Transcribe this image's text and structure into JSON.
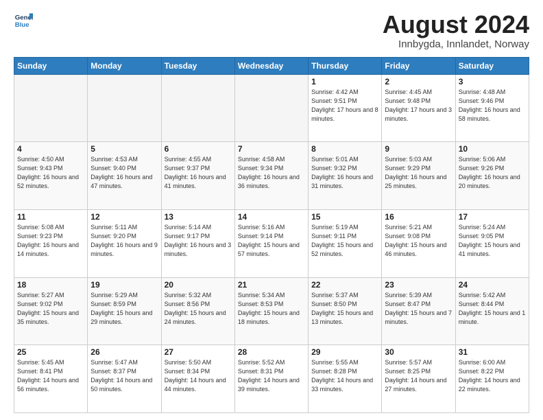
{
  "header": {
    "logo": {
      "line1": "General",
      "line2": "Blue"
    },
    "title": "August 2024",
    "subtitle": "Innbygda, Innlandet, Norway"
  },
  "weekdays": [
    "Sunday",
    "Monday",
    "Tuesday",
    "Wednesday",
    "Thursday",
    "Friday",
    "Saturday"
  ],
  "weeks": [
    [
      {
        "day": "",
        "info": ""
      },
      {
        "day": "",
        "info": ""
      },
      {
        "day": "",
        "info": ""
      },
      {
        "day": "",
        "info": ""
      },
      {
        "day": "1",
        "info": "Sunrise: 4:42 AM\nSunset: 9:51 PM\nDaylight: 17 hours\nand 8 minutes."
      },
      {
        "day": "2",
        "info": "Sunrise: 4:45 AM\nSunset: 9:48 PM\nDaylight: 17 hours\nand 3 minutes."
      },
      {
        "day": "3",
        "info": "Sunrise: 4:48 AM\nSunset: 9:46 PM\nDaylight: 16 hours\nand 58 minutes."
      }
    ],
    [
      {
        "day": "4",
        "info": "Sunrise: 4:50 AM\nSunset: 9:43 PM\nDaylight: 16 hours\nand 52 minutes."
      },
      {
        "day": "5",
        "info": "Sunrise: 4:53 AM\nSunset: 9:40 PM\nDaylight: 16 hours\nand 47 minutes."
      },
      {
        "day": "6",
        "info": "Sunrise: 4:55 AM\nSunset: 9:37 PM\nDaylight: 16 hours\nand 41 minutes."
      },
      {
        "day": "7",
        "info": "Sunrise: 4:58 AM\nSunset: 9:34 PM\nDaylight: 16 hours\nand 36 minutes."
      },
      {
        "day": "8",
        "info": "Sunrise: 5:01 AM\nSunset: 9:32 PM\nDaylight: 16 hours\nand 31 minutes."
      },
      {
        "day": "9",
        "info": "Sunrise: 5:03 AM\nSunset: 9:29 PM\nDaylight: 16 hours\nand 25 minutes."
      },
      {
        "day": "10",
        "info": "Sunrise: 5:06 AM\nSunset: 9:26 PM\nDaylight: 16 hours\nand 20 minutes."
      }
    ],
    [
      {
        "day": "11",
        "info": "Sunrise: 5:08 AM\nSunset: 9:23 PM\nDaylight: 16 hours\nand 14 minutes."
      },
      {
        "day": "12",
        "info": "Sunrise: 5:11 AM\nSunset: 9:20 PM\nDaylight: 16 hours\nand 9 minutes."
      },
      {
        "day": "13",
        "info": "Sunrise: 5:14 AM\nSunset: 9:17 PM\nDaylight: 16 hours\nand 3 minutes."
      },
      {
        "day": "14",
        "info": "Sunrise: 5:16 AM\nSunset: 9:14 PM\nDaylight: 15 hours\nand 57 minutes."
      },
      {
        "day": "15",
        "info": "Sunrise: 5:19 AM\nSunset: 9:11 PM\nDaylight: 15 hours\nand 52 minutes."
      },
      {
        "day": "16",
        "info": "Sunrise: 5:21 AM\nSunset: 9:08 PM\nDaylight: 15 hours\nand 46 minutes."
      },
      {
        "day": "17",
        "info": "Sunrise: 5:24 AM\nSunset: 9:05 PM\nDaylight: 15 hours\nand 41 minutes."
      }
    ],
    [
      {
        "day": "18",
        "info": "Sunrise: 5:27 AM\nSunset: 9:02 PM\nDaylight: 15 hours\nand 35 minutes."
      },
      {
        "day": "19",
        "info": "Sunrise: 5:29 AM\nSunset: 8:59 PM\nDaylight: 15 hours\nand 29 minutes."
      },
      {
        "day": "20",
        "info": "Sunrise: 5:32 AM\nSunset: 8:56 PM\nDaylight: 15 hours\nand 24 minutes."
      },
      {
        "day": "21",
        "info": "Sunrise: 5:34 AM\nSunset: 8:53 PM\nDaylight: 15 hours\nand 18 minutes."
      },
      {
        "day": "22",
        "info": "Sunrise: 5:37 AM\nSunset: 8:50 PM\nDaylight: 15 hours\nand 13 minutes."
      },
      {
        "day": "23",
        "info": "Sunrise: 5:39 AM\nSunset: 8:47 PM\nDaylight: 15 hours\nand 7 minutes."
      },
      {
        "day": "24",
        "info": "Sunrise: 5:42 AM\nSunset: 8:44 PM\nDaylight: 15 hours\nand 1 minute."
      }
    ],
    [
      {
        "day": "25",
        "info": "Sunrise: 5:45 AM\nSunset: 8:41 PM\nDaylight: 14 hours\nand 56 minutes."
      },
      {
        "day": "26",
        "info": "Sunrise: 5:47 AM\nSunset: 8:37 PM\nDaylight: 14 hours\nand 50 minutes."
      },
      {
        "day": "27",
        "info": "Sunrise: 5:50 AM\nSunset: 8:34 PM\nDaylight: 14 hours\nand 44 minutes."
      },
      {
        "day": "28",
        "info": "Sunrise: 5:52 AM\nSunset: 8:31 PM\nDaylight: 14 hours\nand 39 minutes."
      },
      {
        "day": "29",
        "info": "Sunrise: 5:55 AM\nSunset: 8:28 PM\nDaylight: 14 hours\nand 33 minutes."
      },
      {
        "day": "30",
        "info": "Sunrise: 5:57 AM\nSunset: 8:25 PM\nDaylight: 14 hours\nand 27 minutes."
      },
      {
        "day": "31",
        "info": "Sunrise: 6:00 AM\nSunset: 8:22 PM\nDaylight: 14 hours\nand 22 minutes."
      }
    ]
  ]
}
